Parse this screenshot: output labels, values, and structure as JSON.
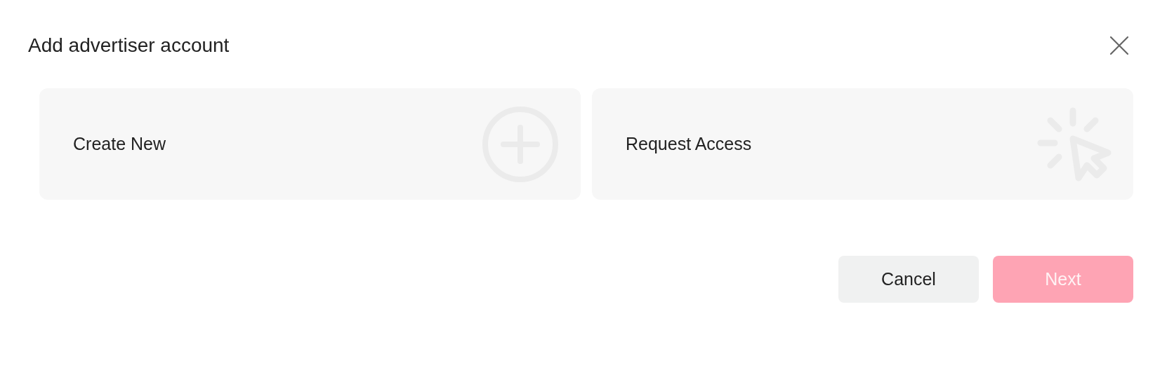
{
  "dialog": {
    "title": "Add advertiser account"
  },
  "options": [
    {
      "label": "Create New",
      "kind": "create",
      "selected": false
    },
    {
      "label": "Request Access",
      "kind": "request",
      "selected": false
    }
  ],
  "buttons": [
    {
      "label": "Cancel",
      "kind": "secondary",
      "disabled": false
    },
    {
      "label": "Next",
      "kind": "primary",
      "disabled": true
    }
  ]
}
